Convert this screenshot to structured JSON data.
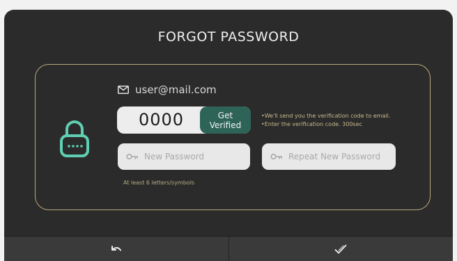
{
  "title": "FORGOT PASSWORD",
  "email": "user@mail.com",
  "verification": {
    "code_value": "0000",
    "get_verified_line1": "Get",
    "get_verified_line2": "Verified",
    "hint_line1": "•We'll send you the verification code to email.",
    "hint_line2": "•Enter the verification code.  300sec"
  },
  "password": {
    "new_placeholder": "New Password",
    "repeat_placeholder": "Repeat New Password",
    "rule": "At least 6 letters/symbols"
  },
  "icons": {
    "lock": "lock-icon",
    "mail": "mail-icon",
    "key": "key-icon",
    "back": "undo-arrow-icon",
    "confirm": "checkmark-icon"
  },
  "colors": {
    "background": "#2b2b2b",
    "accent_gold": "#b9a97c",
    "accent_green": "#2e6458",
    "lock_teal": "#5fcfb3"
  }
}
